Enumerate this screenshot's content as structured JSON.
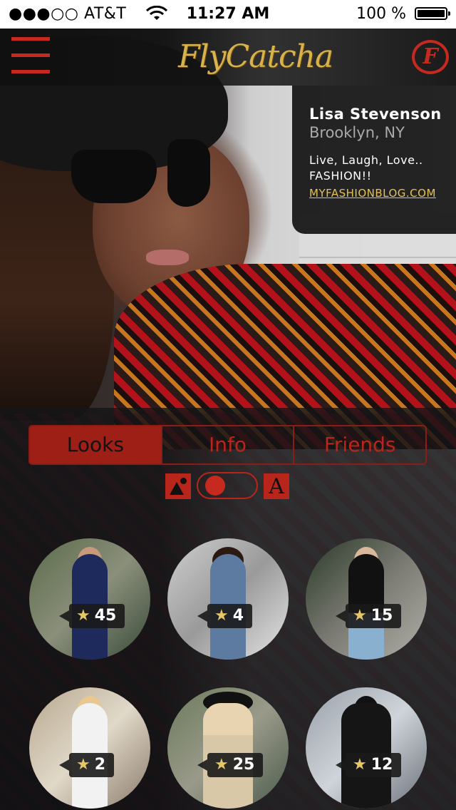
{
  "status_bar": {
    "carrier": "●●●○○ AT&T",
    "time": "11:27 AM",
    "battery": "100 %"
  },
  "navbar": {
    "logo_text": "FlyCatcha",
    "profile_badge": "F"
  },
  "profile": {
    "name": "Lisa Stevenson",
    "location": "Brooklyn, NY",
    "bio_line1": "Live, Laugh, Love..",
    "bio_line2": "FASHION!!",
    "link": "MYFASHIONBLOG.COM"
  },
  "tabs": [
    {
      "label": "Looks",
      "active": true
    },
    {
      "label": "Info",
      "active": false
    },
    {
      "label": "Friends",
      "active": false
    }
  ],
  "view_toggle": {
    "text_icon": "A",
    "selected": "photo"
  },
  "looks": [
    {
      "rating": "45",
      "icon": "star-icon"
    },
    {
      "rating": "4",
      "icon": "star-icon"
    },
    {
      "rating": "15",
      "icon": "star-icon"
    },
    {
      "rating": "2",
      "icon": "star-icon"
    },
    {
      "rating": "25",
      "icon": "star-icon"
    },
    {
      "rating": "12",
      "icon": "star-icon"
    }
  ],
  "colors": {
    "accent_red": "#c62a1f",
    "gold": "#d8b24a",
    "link_yellow": "#e5c158"
  }
}
